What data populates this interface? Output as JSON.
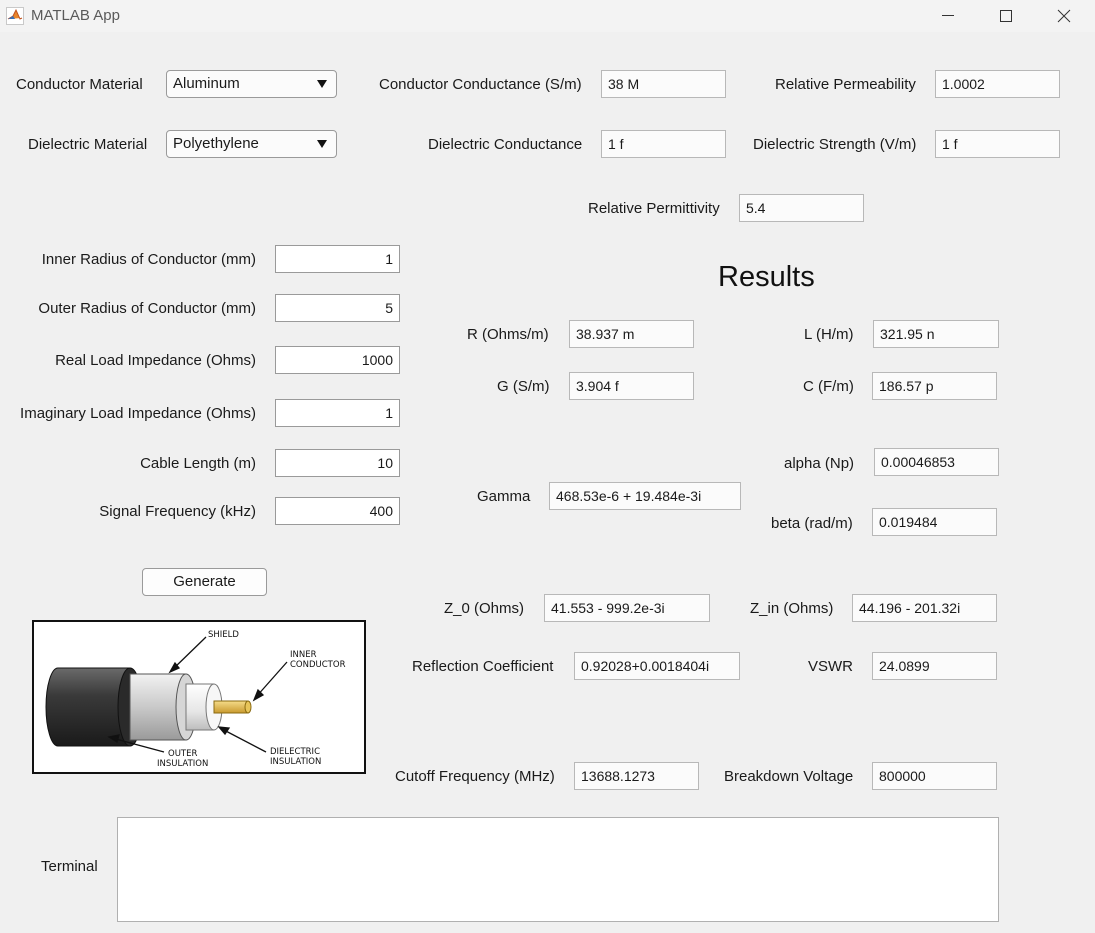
{
  "window": {
    "title": "MATLAB App",
    "icon": "matlab-logo-icon"
  },
  "materials": {
    "conductor_label": "Conductor Material",
    "conductor_value": "Aluminum",
    "dielectric_label": "Dielectric Material",
    "dielectric_value": "Polyethylene"
  },
  "properties": {
    "conductor_conductance": {
      "label": "Conductor Conductance (S/m)",
      "value": "38 M"
    },
    "relative_permeability": {
      "label": "Relative Permeability",
      "value": "1.0002"
    },
    "dielectric_conductance": {
      "label": "Dielectric Conductance",
      "value": "1 f"
    },
    "dielectric_strength": {
      "label": "Dielectric Strength (V/m)",
      "value": "1 f"
    },
    "relative_permittivity": {
      "label": "Relative Permittivity",
      "value": "5.4"
    }
  },
  "inputs": [
    {
      "label": "Inner Radius of Conductor (mm)",
      "value": "1"
    },
    {
      "label": "Outer Radius of Conductor (mm)",
      "value": "5"
    },
    {
      "label": "Real Load Impedance (Ohms)",
      "value": "1000"
    },
    {
      "label": "Imaginary Load Impedance (Ohms)",
      "value": "1"
    },
    {
      "label": "Cable Length (m)",
      "value": "10"
    },
    {
      "label": "Signal Frequency (kHz)",
      "value": "400"
    }
  ],
  "generate_label": "Generate",
  "diagram": {
    "labels": {
      "shield": "SHIELD",
      "inner_1": "INNER",
      "inner_2": "CONDUCTOR",
      "outer_1": "OUTER",
      "outer_2": "INSULATION",
      "diel_1": "DIELECTRIC",
      "diel_2": "INSULATION"
    }
  },
  "results": {
    "heading": "Results",
    "R": {
      "label": "R (Ohms/m)",
      "value": "38.937 m"
    },
    "L": {
      "label": "L (H/m)",
      "value": "321.95 n"
    },
    "G": {
      "label": "G (S/m)",
      "value": "3.904 f"
    },
    "C": {
      "label": "C (F/m)",
      "value": "186.57 p"
    },
    "alpha": {
      "label": "alpha (Np)",
      "value": "0.00046853"
    },
    "gamma": {
      "label": "Gamma",
      "value": "468.53e-6 + 19.484e-3i"
    },
    "beta": {
      "label": "beta (rad/m)",
      "value": "0.019484"
    },
    "z0": {
      "label": "Z_0 (Ohms)",
      "value": "41.553 - 999.2e-3i"
    },
    "zin": {
      "label": "Z_in (Ohms)",
      "value": "44.196 - 201.32i"
    },
    "reflection": {
      "label": "Reflection Coefficient",
      "value": "0.92028+0.0018404i"
    },
    "vswr": {
      "label": "VSWR",
      "value": "24.0899"
    },
    "cutoff": {
      "label": "Cutoff Frequency (MHz)",
      "value": "13688.1273"
    },
    "breakdown": {
      "label": "Breakdown Voltage",
      "value": "800000"
    }
  },
  "terminal": {
    "label": "Terminal",
    "value": ""
  }
}
